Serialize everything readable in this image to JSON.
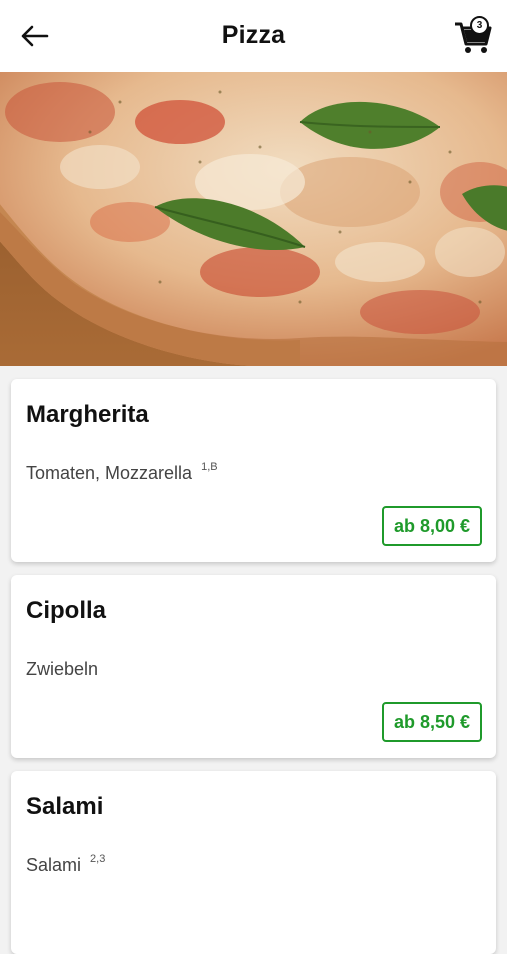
{
  "header": {
    "title": "Pizza",
    "cart_count": "3"
  },
  "icons": {
    "back": "arrow-left-icon",
    "cart": "shopping-cart-icon"
  },
  "colors": {
    "accent_green": "#1f9a2b",
    "background": "#f2f2f2",
    "card": "#ffffff"
  },
  "products": [
    {
      "name": "Margherita",
      "description": "Tomaten, Mozzarella",
      "footnotes": "1,B",
      "price": "ab 8,00 €"
    },
    {
      "name": "Cipolla",
      "description": "Zwiebeln",
      "footnotes": "",
      "price": "ab 8,50 €"
    },
    {
      "name": "Salami",
      "description": "Salami",
      "footnotes": "2,3",
      "price": ""
    }
  ]
}
